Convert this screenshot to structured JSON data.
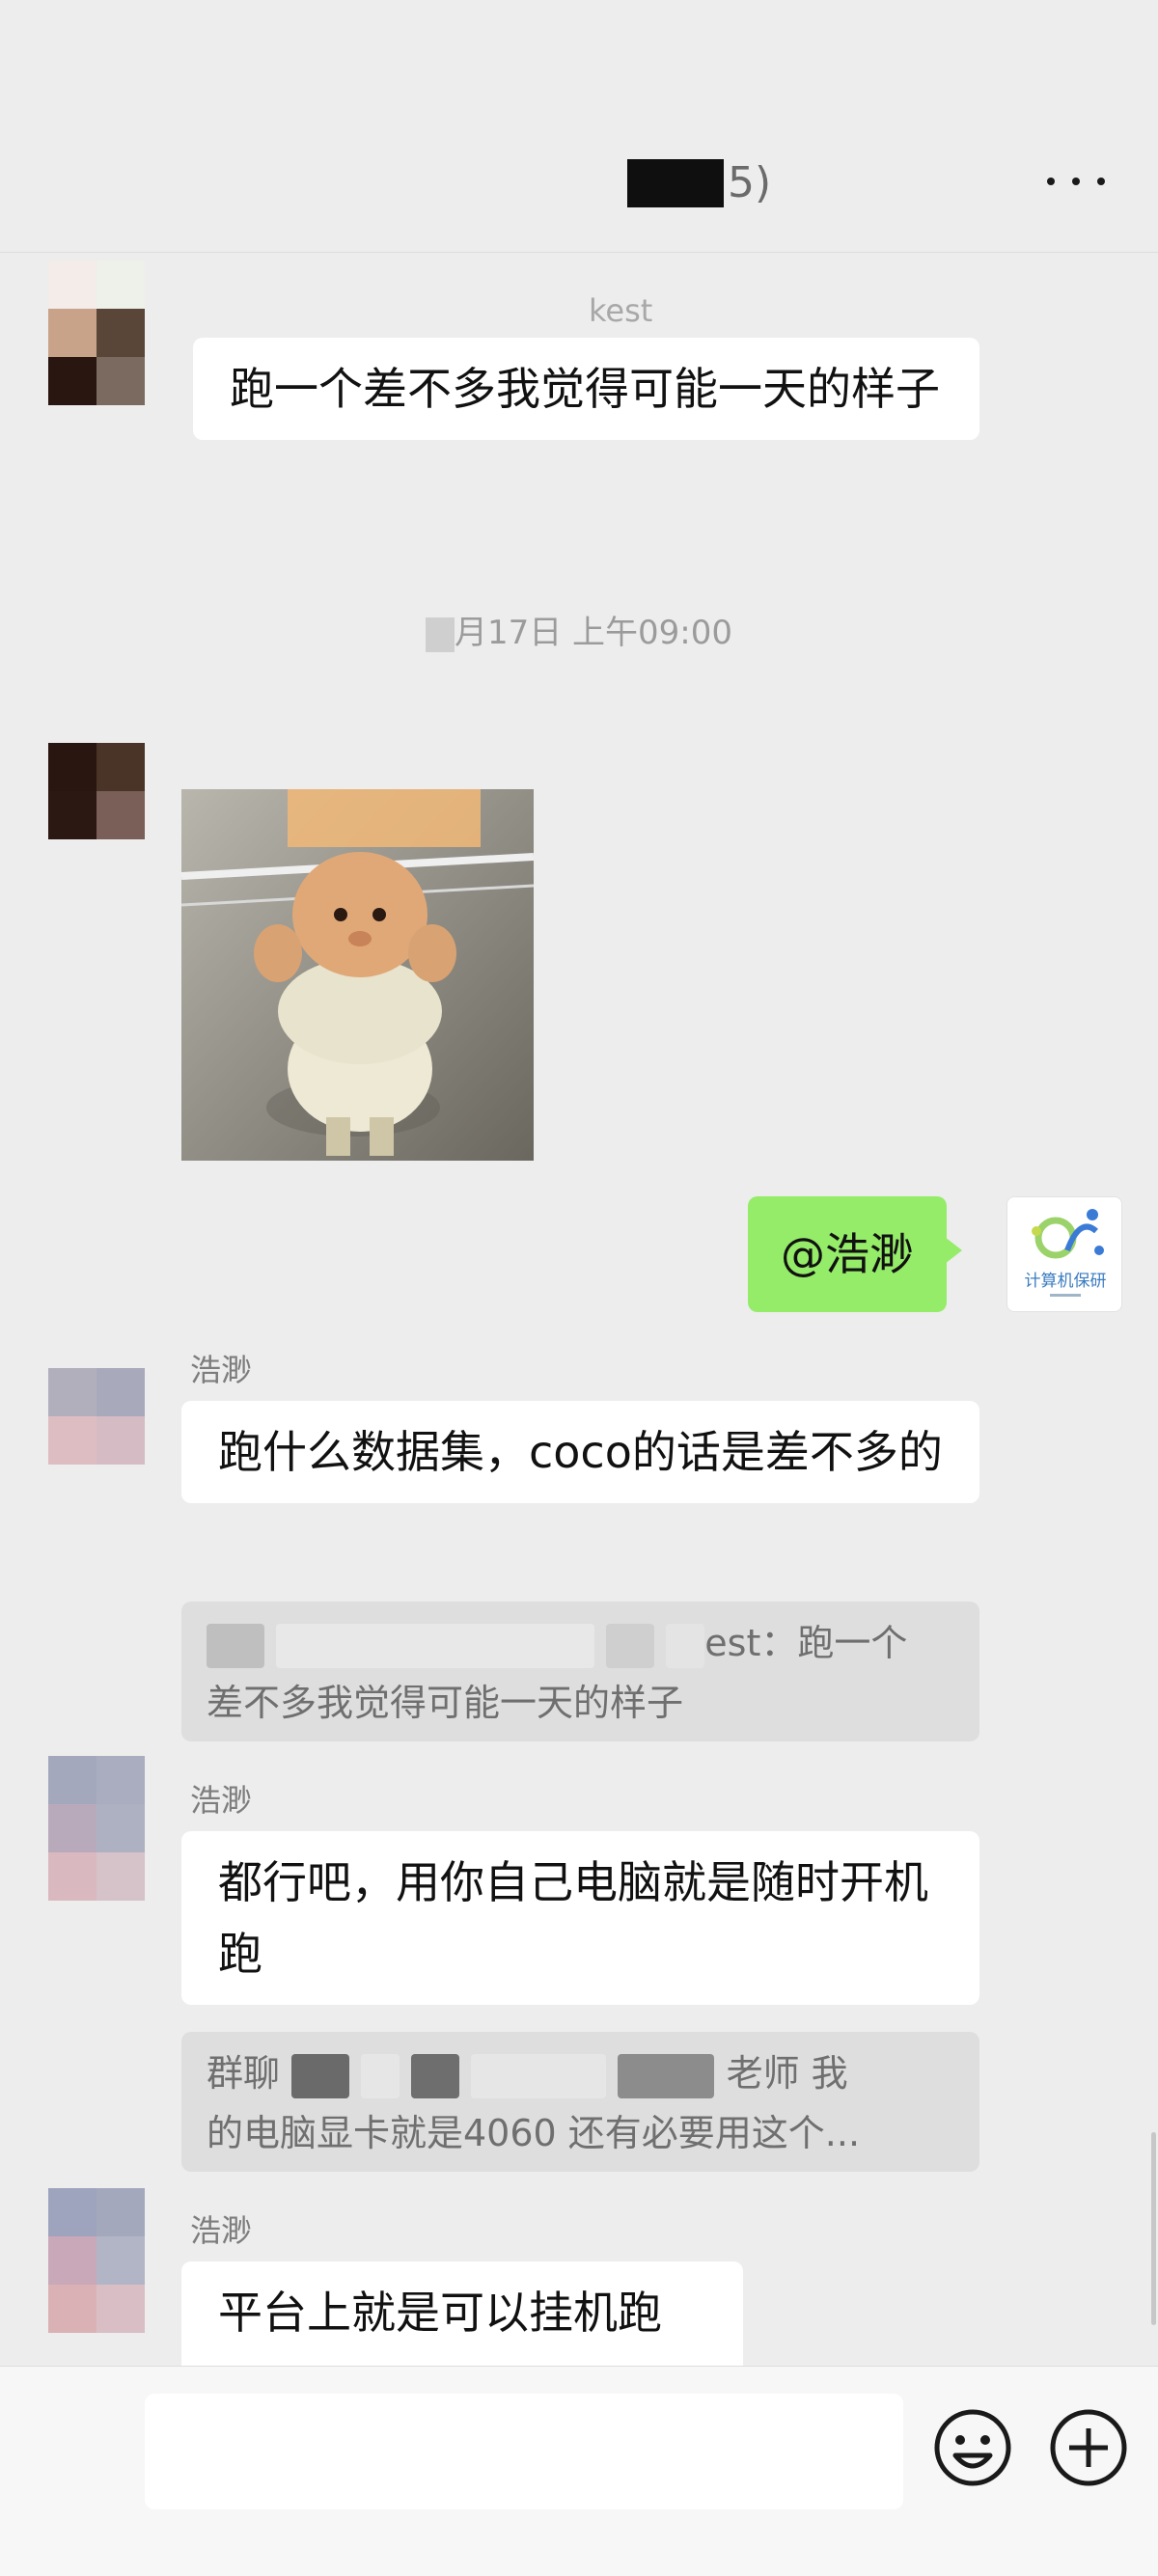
{
  "header": {
    "title_suffix": "5)",
    "more_icon": "more-dots-icon"
  },
  "messages": [
    {
      "sender_partial": "kest",
      "text": "跑一个差不多我觉得可能一天的样子"
    }
  ],
  "timestamp": "月17日 上午09:00",
  "my_message": {
    "text": "@浩渺",
    "avatar_label": "计算机保研"
  },
  "replies": [
    {
      "sender": "浩渺",
      "text": "跑什么数据集，coco的话是差不多的",
      "quote_tail": "est：跑一个",
      "quote_line2": "差不多我觉得可能一天的样子"
    },
    {
      "sender": "浩渺",
      "text": "都行吧，用你自己电脑就是随时开机跑",
      "quote_head": "群聊",
      "quote_tail": "老师 我",
      "quote_line2": "的电脑显卡就是4060 还有必要用这个..."
    },
    {
      "sender": "浩渺",
      "text": "平台上就是可以挂机跑"
    }
  ],
  "input_bar": {
    "emoji_icon": "emoji-icon",
    "plus_icon": "plus-icon"
  }
}
